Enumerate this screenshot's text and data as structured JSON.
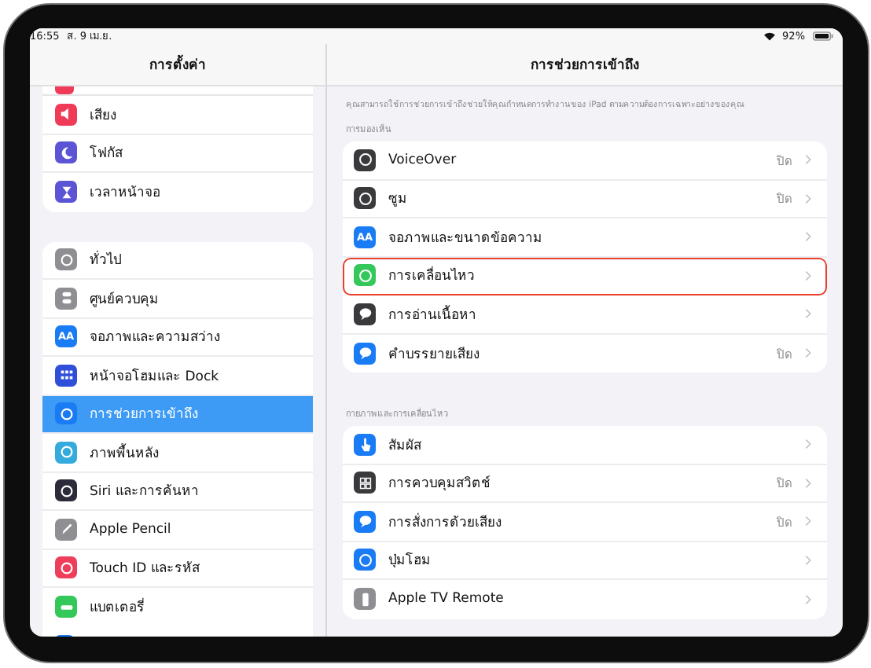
{
  "status_bar": {
    "time": "16:55",
    "date": "ส. 9 เม.ย.",
    "battery": "92%"
  },
  "sidebar": {
    "title": "การตั้งค่า",
    "groups": [
      [
        {
          "label": "เสียง",
          "color": "#ef3b57",
          "selected": false
        },
        {
          "label": "โฟกัส",
          "color": "#5b55d6",
          "selected": false
        },
        {
          "label": "เวลาหน้าจอ",
          "color": "#5b55d6",
          "selected": false
        }
      ],
      [
        {
          "label": "ทั่วไป",
          "color": "#8e8e93",
          "selected": false
        },
        {
          "label": "ศูนย์ควบคุม",
          "color": "#8e8e93",
          "selected": false
        },
        {
          "label": "จอภาพและความสว่าง",
          "color": "#1a7cf5",
          "icon_text": "AA",
          "selected": false
        },
        {
          "label": "หน้าจอโฮมและ Dock",
          "color": "#2f4fd8",
          "selected": false
        },
        {
          "label": "การช่วยการเข้าถึง",
          "color": "#1a7cf5",
          "selected": true
        },
        {
          "label": "ภาพพื้นหลัง",
          "color": "#35aadc",
          "selected": false
        },
        {
          "label": "Siri และการค้นหา",
          "color": "#2b2b3a",
          "selected": false
        },
        {
          "label": "Apple Pencil",
          "color": "#8e8e93",
          "selected": false
        },
        {
          "label": "Touch ID และรหัส",
          "color": "#ee3e5c",
          "selected": false
        },
        {
          "label": "แบตเตอรี่",
          "color": "#34c759",
          "selected": false
        }
      ]
    ]
  },
  "detail": {
    "title": "การช่วยการเข้าถึง",
    "description": "คุณสามารถใช้การช่วยการเข้าถึงช่วยให้คุณกำหนดการทำงานของ iPad ตามความต้องการเฉพาะอย่างของคุณ",
    "sections": [
      {
        "header": "การมองเห็น",
        "rows": [
          {
            "label": "VoiceOver",
            "value": "ปิด",
            "color": "#3a3a3c",
            "highlighted": false
          },
          {
            "label": "ซูม",
            "value": "ปิด",
            "color": "#3a3a3c",
            "highlighted": false
          },
          {
            "label": "จอภาพและขนาดข้อความ",
            "color": "#1a7cf5",
            "icon_text": "AA",
            "highlighted": false
          },
          {
            "label": "การเคลื่อนไหว",
            "color": "#34c759",
            "highlighted": true
          },
          {
            "label": "การอ่านเนื้อหา",
            "color": "#3a3a3c",
            "highlighted": false
          },
          {
            "label": "คำบรรยายเสียง",
            "value": "ปิด",
            "color": "#1a7cf5",
            "highlighted": false
          }
        ]
      },
      {
        "header": "กายภาพและการเคลื่อนไหว",
        "rows": [
          {
            "label": "สัมผัส",
            "color": "#1a7cf5",
            "highlighted": false
          },
          {
            "label": "การควบคุมสวิตช์",
            "value": "ปิด",
            "color": "#3a3a3c",
            "highlighted": false
          },
          {
            "label": "การสั่งการด้วยเสียง",
            "value": "ปิด",
            "color": "#1a7cf5",
            "highlighted": false
          },
          {
            "label": "ปุ่มโฮม",
            "color": "#1a7cf5",
            "highlighted": false
          },
          {
            "label": "Apple TV Remote",
            "color": "#8e8e93",
            "highlighted": false
          }
        ]
      }
    ]
  }
}
